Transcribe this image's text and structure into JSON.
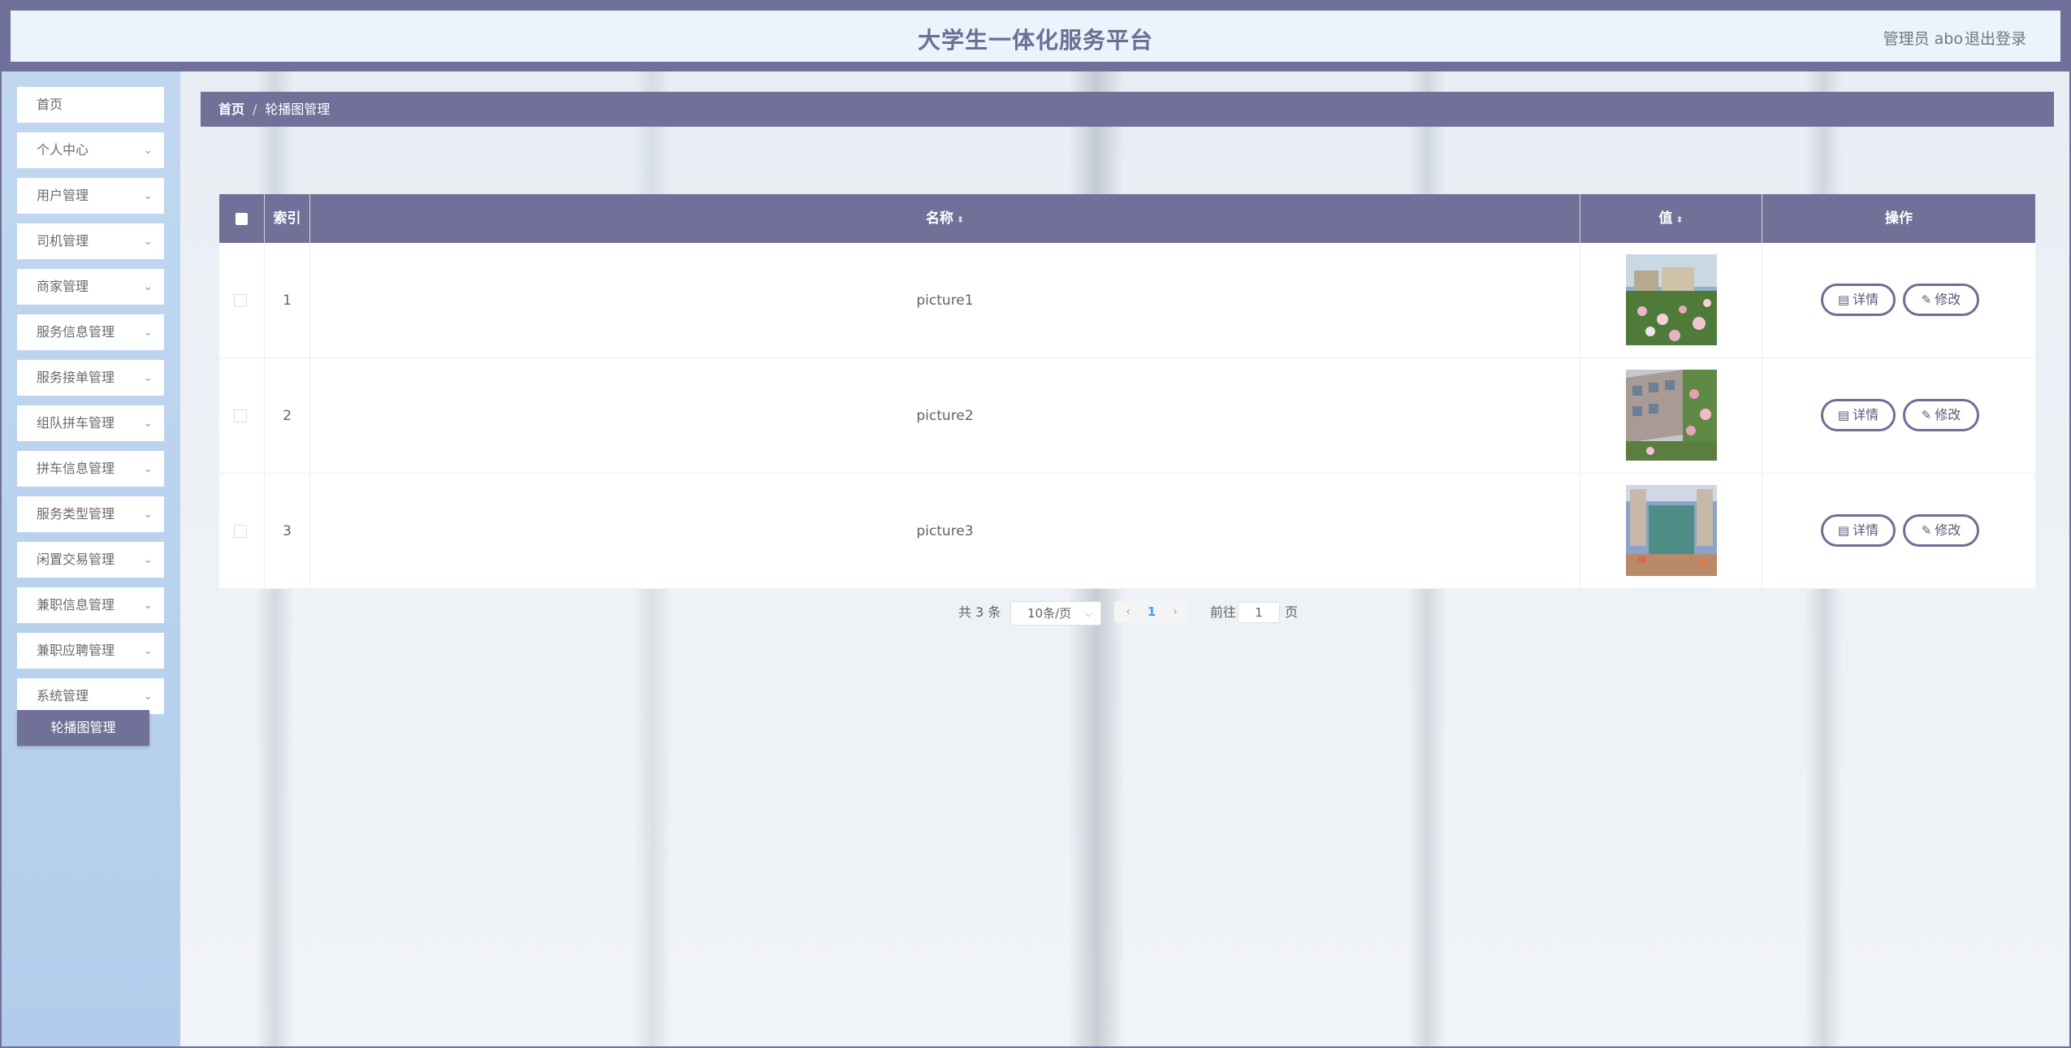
{
  "header": {
    "title": "大学生一体化服务平台",
    "user_label": "管理员 abo",
    "logout_label": "退出登录"
  },
  "sidebar": {
    "items": [
      {
        "label": "首页",
        "has_chevron": false
      },
      {
        "label": "个人中心",
        "has_chevron": true
      },
      {
        "label": "用户管理",
        "has_chevron": true
      },
      {
        "label": "司机管理",
        "has_chevron": true
      },
      {
        "label": "商家管理",
        "has_chevron": true
      },
      {
        "label": "服务信息管理",
        "has_chevron": true
      },
      {
        "label": "服务接单管理",
        "has_chevron": true
      },
      {
        "label": "组队拼车管理",
        "has_chevron": true
      },
      {
        "label": "拼车信息管理",
        "has_chevron": true
      },
      {
        "label": "服务类型管理",
        "has_chevron": true
      },
      {
        "label": "闲置交易管理",
        "has_chevron": true
      },
      {
        "label": "兼职信息管理",
        "has_chevron": true
      },
      {
        "label": "兼职应聘管理",
        "has_chevron": true
      },
      {
        "label": "系统管理",
        "has_chevron": true
      }
    ],
    "active_subitem": "轮播图管理"
  },
  "breadcrumb": {
    "home": "首页",
    "separator": "/",
    "current": "轮播图管理"
  },
  "table": {
    "columns": [
      "索引",
      "名称",
      "值",
      "操作"
    ],
    "rows": [
      {
        "index": "1",
        "name": "picture1",
        "thumb": "garden-flowers"
      },
      {
        "index": "2",
        "name": "picture2",
        "thumb": "building-flowers"
      },
      {
        "index": "3",
        "name": "picture3",
        "thumb": "interior-hall"
      }
    ],
    "detail_label": "详情",
    "edit_label": "修改"
  },
  "pagination": {
    "total_text": "共 3 条",
    "page_size": "10条/页",
    "current_page": "1",
    "goto_label": "前往",
    "goto_value": "1",
    "page_unit": "页"
  },
  "colors": {
    "primary": "#707099",
    "header_bg": "#e9f4fd",
    "sidebar_bg": "#b8d1ee"
  }
}
